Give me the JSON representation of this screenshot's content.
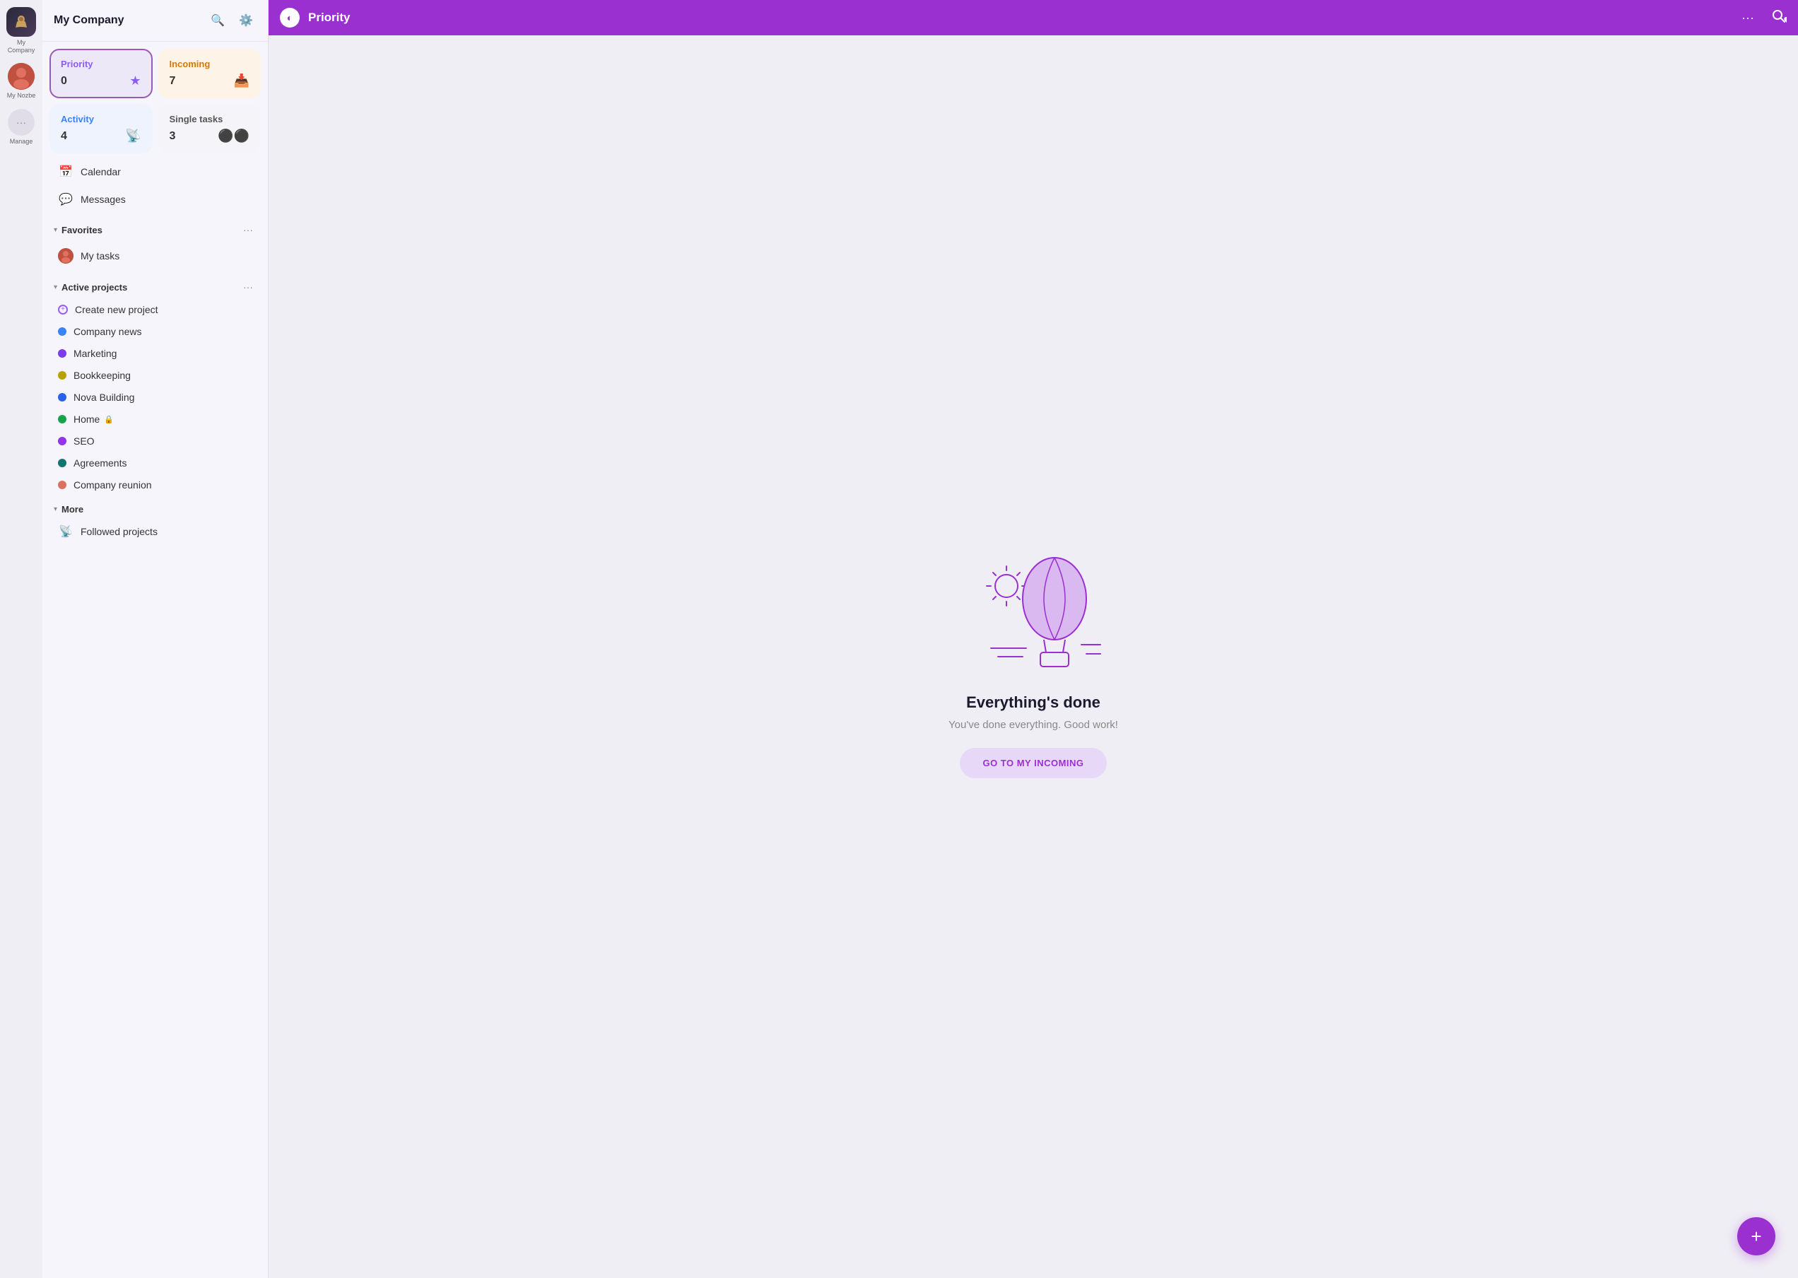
{
  "iconBar": {
    "companyLabel": "My Company",
    "userLabel": "My Nozbe",
    "manageLabel": "Manage"
  },
  "sidebar": {
    "title": "My Company",
    "searchLabel": "Search",
    "settingsLabel": "Settings",
    "cards": [
      {
        "id": "priority",
        "label": "Priority",
        "count": "0",
        "iconUnicode": "★",
        "type": "priority"
      },
      {
        "id": "incoming",
        "label": "Incoming",
        "count": "7",
        "iconUnicode": "📥",
        "type": "incoming"
      },
      {
        "id": "activity",
        "label": "Activity",
        "count": "4",
        "iconUnicode": "📡",
        "type": "activity"
      },
      {
        "id": "single",
        "label": "Single tasks",
        "count": "3",
        "iconUnicode": "⚫",
        "type": "single"
      }
    ],
    "navItems": [
      {
        "id": "calendar",
        "label": "Calendar",
        "icon": "📅"
      },
      {
        "id": "messages",
        "label": "Messages",
        "icon": "💬"
      }
    ],
    "favoritesLabel": "Favorites",
    "favoriteItems": [
      {
        "id": "my-tasks",
        "label": "My tasks"
      }
    ],
    "activeProjectsLabel": "Active projects",
    "projects": [
      {
        "id": "create",
        "label": "Create new project",
        "dotColor": null,
        "isCreate": true
      },
      {
        "id": "company-news",
        "label": "Company news",
        "dotColor": "#3b82f6"
      },
      {
        "id": "marketing",
        "label": "Marketing",
        "dotColor": "#7c3aed"
      },
      {
        "id": "bookkeeping",
        "label": "Bookkeeping",
        "dotColor": "#b8a200"
      },
      {
        "id": "nova-building",
        "label": "Nova Building",
        "dotColor": "#2563eb"
      },
      {
        "id": "home",
        "label": "Home",
        "dotColor": "#16a34a",
        "lock": true
      },
      {
        "id": "seo",
        "label": "SEO",
        "dotColor": "#9333ea"
      },
      {
        "id": "agreements",
        "label": "Agreements",
        "dotColor": "#0f766e"
      },
      {
        "id": "company-reunion",
        "label": "Company reunion",
        "dotColor": "#d97060"
      }
    ],
    "moreLabel": "More",
    "moreItems": [
      {
        "id": "followed-projects",
        "label": "Followed projects",
        "icon": "📡"
      }
    ]
  },
  "topbar": {
    "title": "Priority",
    "logoSymbol": "◐"
  },
  "main": {
    "illustrationAlt": "Hot air balloon illustration",
    "title": "Everything's done",
    "subtitle": "You've done everything. Good work!",
    "buttonLabel": "GO TO MY INCOMING"
  },
  "fab": {
    "label": "+"
  }
}
